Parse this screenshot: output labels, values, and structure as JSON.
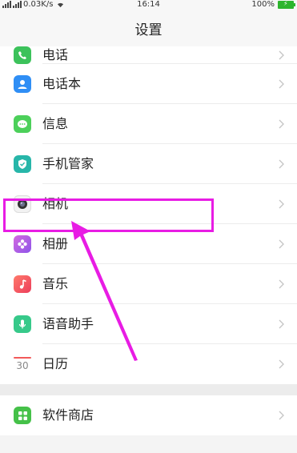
{
  "status": {
    "speed": "0.03K/s",
    "time": "16:14",
    "battery": "100%"
  },
  "title": "设置",
  "colors": {
    "highlight": "#e81ce4",
    "phone": "#3cc25b",
    "contacts": "#2f8ef5",
    "messages": "#4cd05a",
    "phone_manager": "#27b6a9",
    "camera": "#f2f2f2",
    "album": "#b05ce0",
    "music": "#f25a5a",
    "assistant": "#37c98a",
    "store": "#45c149"
  },
  "settings": {
    "group1": [
      {
        "label": "电话",
        "icon": "phone-icon"
      },
      {
        "label": "电话本",
        "icon": "contacts-icon"
      },
      {
        "label": "信息",
        "icon": "message-icon"
      },
      {
        "label": "手机管家",
        "icon": "shield-icon"
      },
      {
        "label": "相机",
        "icon": "camera-icon"
      },
      {
        "label": "相册",
        "icon": "flower-icon"
      },
      {
        "label": "音乐",
        "icon": "music-icon"
      },
      {
        "label": "语音助手",
        "icon": "mic-icon"
      },
      {
        "label": "日历",
        "icon": "calendar-icon",
        "day": "30"
      }
    ],
    "group2": [
      {
        "label": "软件商店",
        "icon": "store-icon"
      }
    ]
  }
}
